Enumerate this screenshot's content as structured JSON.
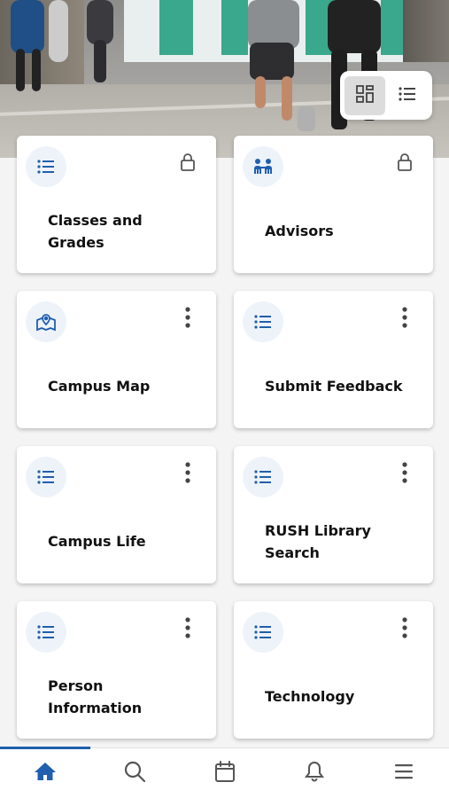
{
  "hero": {
    "image": "campus-walkway-photo"
  },
  "view_toggle": {
    "options": [
      {
        "icon": "grid-view-icon",
        "selected": true
      },
      {
        "icon": "list-view-icon",
        "selected": false
      }
    ]
  },
  "cards": [
    {
      "title": "Classes and Grades",
      "icon": "list-icon",
      "action": "lock-icon"
    },
    {
      "title": "Advisors",
      "icon": "people-icon",
      "action": "lock-icon"
    },
    {
      "title": "Campus Map",
      "icon": "map-pin-icon",
      "action": "more-vertical-icon"
    },
    {
      "title": "Submit Feedback",
      "icon": "list-icon",
      "action": "more-vertical-icon"
    },
    {
      "title": "Campus Life",
      "icon": "list-icon",
      "action": "more-vertical-icon"
    },
    {
      "title": "RUSH Library Search",
      "icon": "list-icon",
      "action": "more-vertical-icon"
    },
    {
      "title": "Person Information",
      "icon": "list-icon",
      "action": "more-vertical-icon"
    },
    {
      "title": "Technology",
      "icon": "list-icon",
      "action": "more-vertical-icon"
    }
  ],
  "bottom_nav": {
    "items": [
      {
        "icon": "home-icon",
        "active": true
      },
      {
        "icon": "search-icon",
        "active": false
      },
      {
        "icon": "calendar-icon",
        "active": false
      },
      {
        "icon": "bell-icon",
        "active": false
      },
      {
        "icon": "menu-icon",
        "active": false
      }
    ]
  },
  "colors": {
    "accent": "#1f5fad",
    "icon_bg": "#eef3fa",
    "card_bg": "#ffffff",
    "page_bg": "#f4f4f5",
    "text": "#111111",
    "muted_icon": "#555555"
  }
}
